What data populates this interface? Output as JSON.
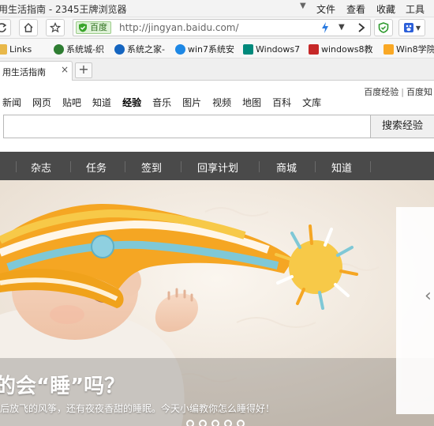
{
  "window": {
    "title": "用生活指南 - 2345王牌浏览器",
    "menu": [
      "文件",
      "查看",
      "收藏",
      "工具"
    ]
  },
  "addressbar": {
    "security_label": "百度",
    "url": "http://jingyan.baidu.com/"
  },
  "bookmarks": [
    {
      "label": "Links",
      "icon": "folder-icon",
      "color": "#e8b84a"
    },
    {
      "label": "系统城-织",
      "icon": "site-icon",
      "color": "#2e7d32"
    },
    {
      "label": "系统之家-",
      "icon": "site-icon",
      "color": "#1565c0"
    },
    {
      "label": "win7系统安",
      "icon": "site-icon",
      "color": "#1e88e5"
    },
    {
      "label": "Windows7",
      "icon": "site-icon",
      "color": "#00897b"
    },
    {
      "label": "windows8教",
      "icon": "site-icon",
      "color": "#c62828"
    },
    {
      "label": "Win8学院",
      "icon": "site-icon",
      "color": "#f9a825"
    }
  ],
  "tab": {
    "label": "用生活指南",
    "new_tab": "+"
  },
  "baidu": {
    "right_links": [
      "百度经验",
      "百度知"
    ],
    "nav": [
      "新闻",
      "网页",
      "贴吧",
      "知道",
      "经验",
      "音乐",
      "图片",
      "视频",
      "地图",
      "百科",
      "文库"
    ],
    "active_nav": "经验",
    "search_button": "搜索经验",
    "search_placeholder": ""
  },
  "darknav": [
    "杂志",
    "任务",
    "签到",
    "回享计划",
    "商城",
    "知道"
  ],
  "hero": {
    "headline": "的会“睡”吗？",
    "subtext": "后放飞的风筝，还有夜夜香甜的睡眠。今天小编教你怎么睡得好！",
    "dots_count": 5
  }
}
